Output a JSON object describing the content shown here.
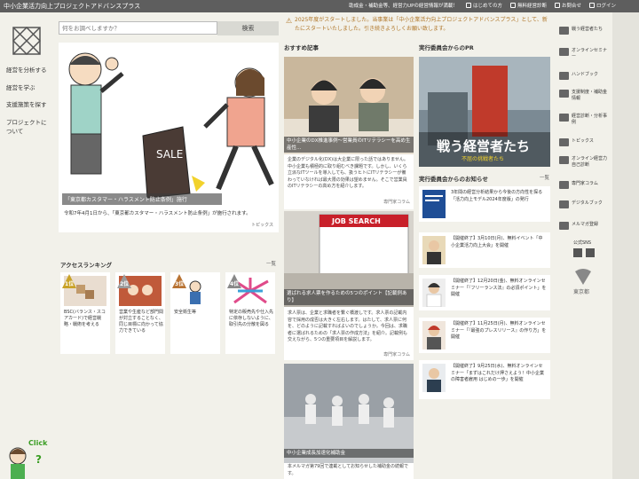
{
  "header": {
    "title": "中小企業活力向上プロジェクトアドバンスプラス",
    "nav": [
      {
        "label": "助成金・補助金等、経営力UPの経営情報が満載！"
      },
      {
        "label": "はじめての方"
      },
      {
        "label": "無料経営診断"
      },
      {
        "label": "お問合せ"
      },
      {
        "label": "ログイン"
      }
    ]
  },
  "left_nav": {
    "items": [
      "経営を分析する",
      "経営を学ぶ",
      "支援施策を探す",
      "プロジェクトに",
      "ついて"
    ]
  },
  "search": {
    "placeholder": "何をお調べしますか？",
    "button": "検索"
  },
  "notice": {
    "text": "2025年度がスタートしました。当事業は「中小企業活力向上プロジェクトアドバンスプラス」として、新たにスタートいたしました。引き続きよろしくお願い致します。"
  },
  "hero": {
    "sign": "SALE",
    "caption": "「東京都カスタマー・ハラスメント防止条例」施行",
    "date_text": "令和7年4月1日から、「東京都カスタマー・ハラスメント防止条例」が施行されます。",
    "category": "トピックス"
  },
  "ranking": {
    "title": "アクセスランキング",
    "more": "一覧",
    "items": [
      {
        "rank": "1位",
        "text": "BSC(バランス・スコアカード)で経営戦略・戦術を考える",
        "color": "#c9a227"
      },
      {
        "rank": "2位",
        "text": "営業や生産など部門間が対立することなく、同じ目標に向かって協力できている",
        "color": "#9a9a9a"
      },
      {
        "rank": "3位",
        "text": "安全衛生等",
        "color": "#b87333"
      },
      {
        "rank": "4位",
        "text": "特定の販売先や仕入先に依存しないように、取引先の分散を図る",
        "color": "#888888"
      }
    ]
  },
  "recommended": {
    "title": "おすすめ記事",
    "articles": [
      {
        "caption": "中小企業のDX推進事例～営業員のITリテラシーを高め生産性…",
        "body": "企業のデジタル化(DX)は大企業に限った話ではありません。中小企業も積極的に取り組むべき課題です。しかし、いくら立派なITツールを導入しても、扱うヒトにITリテラシーが備わっていなければ最大限の効果は望めません。そこで営業員のITリテラシーの高め方を紹介します。",
        "tag": "専門家コラム"
      },
      {
        "caption": "選ばれる求人票を作るための5つのポイント【記載例あり】",
        "sign": "JOB SEARCH",
        "body": "求人票は、企業と求職者を繋ぐ橋渡しです。求人票の記載内容で採用の成否は大きく左右します。はたして、求人票に何を、どのように記載すればよいのでしょうか。今回は、求職者に選ばれるための「求人票の作成方法」を紹介。記載例も交えながら、5つの重要項目を解説します。",
        "tag": "専門家コラム"
      },
      {
        "caption": "中小企業成長加速化補助金",
        "body": "本メルマガ第79回で連載としてお知らせした補助金の続報です。"
      }
    ]
  },
  "pr": {
    "title": "実行委員会からのPR",
    "banner_text": "戦う経営者たち",
    "banner_sub": "不屈の挑戦者たち"
  },
  "news": {
    "title": "実行委員会からのお知らせ",
    "more": "一覧",
    "items": [
      {
        "text": "3年間の経営分析結果から今後の方向性を探る「活力向上モデル2024年度版」の発行"
      },
      {
        "text": "【開催終了】3月10日(月)、無料イベント「中小企業活力向上大会」を開催"
      },
      {
        "text": "【開催終了】12月20日(金)、無料オンラインセミナー「『フリーランス法』の必須ポイント」を開催"
      },
      {
        "text": "【開催終了】11月25日(月)、無料オンラインセミナー「『最強のプレスリリース』の作り方」を開催"
      },
      {
        "text": "【開催終了】9月25日(水)、無料オンラインセミナー「まずはこれだけ押さえよう！中小企業の障害者雇用 はじめの一歩」を開催"
      }
    ]
  },
  "right_nav": {
    "items": [
      "戦う経営者たち",
      "オンラインセミナー",
      "ハンドブック",
      "支援制度・補助金情報",
      "経営診断・分析事例",
      "トピックス",
      "オンライン経営力自己診断",
      "専門家コラム",
      "デジタルブック",
      "メルマガ登録"
    ],
    "sns_label": "公式SNS",
    "tokyo_label": "東京都"
  },
  "click_me": "Click Me"
}
